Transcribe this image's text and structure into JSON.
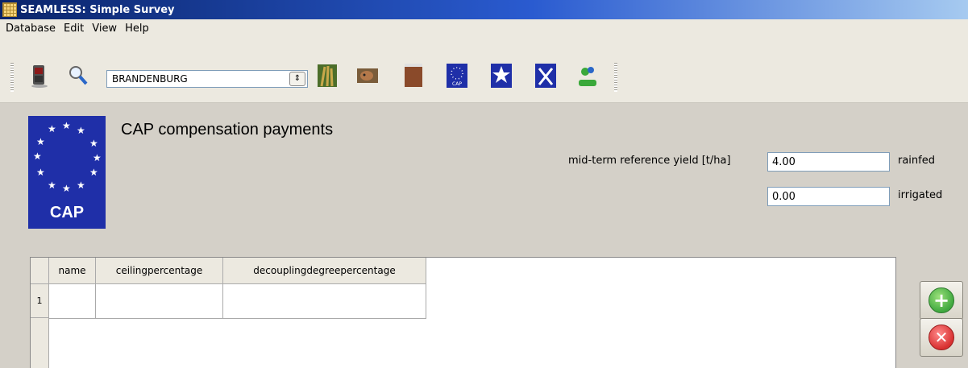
{
  "window": {
    "title": "SEAMLESS: Simple Survey"
  },
  "menu": [
    "Database",
    "Edit",
    "View",
    "Help"
  ],
  "toolbar": {
    "region_select": {
      "value": "BRANDENBURG"
    },
    "icons": [
      "phone-icon",
      "search-icon",
      "crop-icon",
      "cow-icon",
      "soil-icon",
      "cap-icon",
      "natura-icon",
      "eu-policy-icon",
      "people-icon"
    ]
  },
  "page": {
    "title": "CAP compensation payments",
    "logo_text": "CAP"
  },
  "yield": {
    "label": "mid-term reference yield [t/ha]",
    "rainfed_value": "4.00",
    "rainfed_label": "rainfed",
    "irrigated_value": "0.00",
    "irrigated_label": "irrigated"
  },
  "table": {
    "columns": [
      "name",
      "ceilingpercentage",
      "decouplingdegreepercentage"
    ],
    "rows": [
      {
        "num": "1",
        "name": "",
        "ceilingpercentage": "",
        "decouplingdegreepercentage": ""
      }
    ]
  },
  "buttons": {
    "add": "add-icon",
    "remove": "remove-icon"
  },
  "colors": {
    "titlebar": "#0a246a",
    "cap_blue": "#1f2fa8",
    "add_green": "#3fa83f",
    "remove_red": "#d83030"
  }
}
